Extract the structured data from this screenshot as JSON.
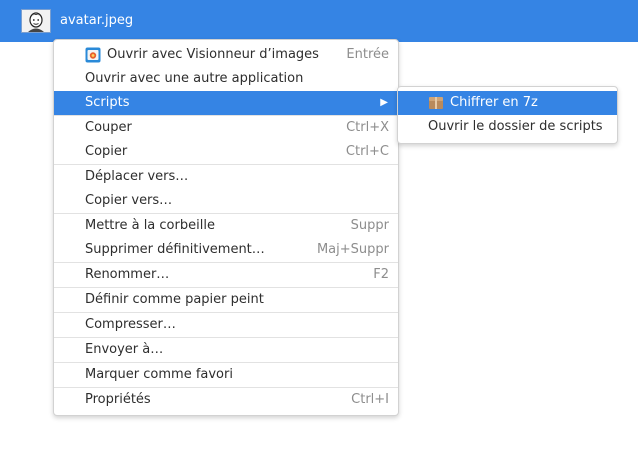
{
  "file": {
    "name": "avatar.jpeg",
    "thumbnail_icon": "avatar-thumbnail"
  },
  "context_menu": {
    "groups": [
      [
        {
          "label": "Ouvrir avec Visionneur d’images",
          "accel": "Entrée",
          "icon": "image-viewer-icon"
        },
        {
          "label": "Ouvrir avec une autre application",
          "accel": ""
        },
        {
          "label": "Scripts",
          "accel": "",
          "has_submenu": true,
          "selected": true
        }
      ],
      [
        {
          "label": "Couper",
          "accel": "Ctrl+X"
        },
        {
          "label": "Copier",
          "accel": "Ctrl+C"
        }
      ],
      [
        {
          "label": "Déplacer vers…",
          "accel": ""
        },
        {
          "label": "Copier vers…",
          "accel": ""
        }
      ],
      [
        {
          "label": "Mettre à la corbeille",
          "accel": "Suppr"
        },
        {
          "label": "Supprimer définitivement…",
          "accel": "Maj+Suppr"
        }
      ],
      [
        {
          "label": "Renommer…",
          "accel": "F2"
        }
      ],
      [
        {
          "label": "Définir comme papier peint",
          "accel": ""
        }
      ],
      [
        {
          "label": "Compresser…",
          "accel": ""
        }
      ],
      [
        {
          "label": "Envoyer à…",
          "accel": ""
        }
      ],
      [
        {
          "label": "Marquer comme favori",
          "accel": ""
        }
      ],
      [
        {
          "label": "Propriétés",
          "accel": "Ctrl+I"
        }
      ]
    ]
  },
  "scripts_submenu": {
    "items": [
      {
        "label": "Chiffrer en 7z",
        "icon": "package-icon",
        "selected": true
      },
      {
        "label": "Ouvrir le dossier de scripts"
      }
    ]
  },
  "colors": {
    "accent": "#3584e4",
    "accel_text": "#8d8d8d",
    "separator": "#e2e2e2"
  }
}
